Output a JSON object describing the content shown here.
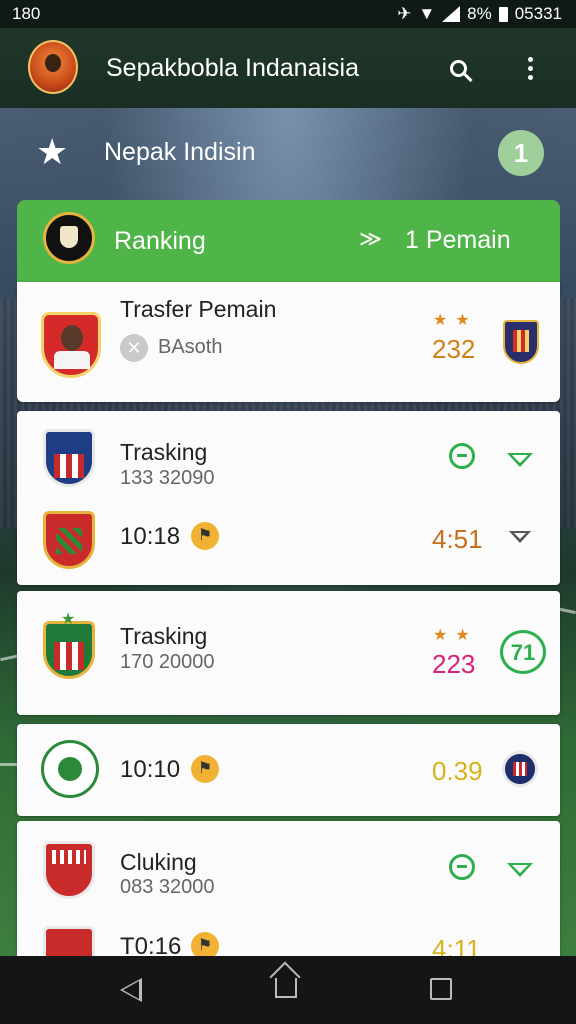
{
  "status_bar": {
    "time_left": "180",
    "battery": "8%",
    "clock": "05331"
  },
  "app_bar": {
    "title": "Sepakbobla Indanaisia"
  },
  "subheader": {
    "title": "Nepak Indisin",
    "badge": "1"
  },
  "ranking": {
    "title": "Ranking",
    "count": "1 Pemain"
  },
  "rows": [
    {
      "title": "Trasfer Pemain",
      "subtitle": "BAsoth",
      "score": "232",
      "stars": "★★"
    },
    {
      "title": "Trasking",
      "subtitle": "133 32090",
      "time": "10:18",
      "score": "4:51"
    },
    {
      "title": "Trasking",
      "subtitle": "170 20000",
      "score": "223",
      "stars": "★★",
      "badge": "71"
    },
    {
      "time": "10:10",
      "score": "0.39"
    },
    {
      "title": "Cluking",
      "subtitle": "083 32000",
      "time": "T0:16",
      "score": "4:11"
    }
  ],
  "colors": {
    "accent_green": "#4fb548",
    "score_orange": "#d0801b",
    "score_magenta": "#d6227a",
    "score_yellow": "#d8b21a",
    "live_green": "#2eaf4c"
  },
  "icons": [
    "app-logo-icon",
    "search-icon",
    "more-vert-icon",
    "star-icon",
    "chevron-down-icon",
    "whistle-icon",
    "clear-icon",
    "live-icon",
    "expand-icon",
    "nav-back-icon",
    "nav-home-icon",
    "nav-recent-icon"
  ]
}
